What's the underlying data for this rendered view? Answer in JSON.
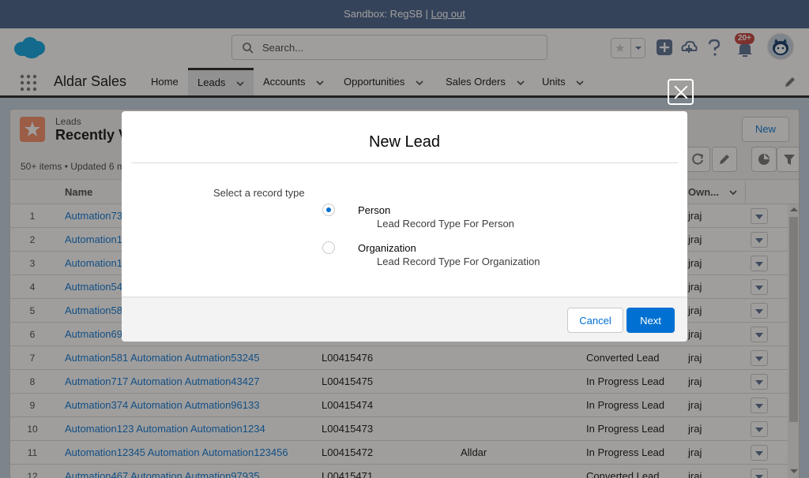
{
  "sandbox": {
    "text": "Sandbox: RegSB | ",
    "logout": "Log out"
  },
  "header": {
    "search_placeholder": "Search...",
    "notifications_badge": "20+",
    "icons": [
      "cloud-logo",
      "search-icon",
      "favorite-star-icon",
      "add-icon",
      "setup-icon",
      "help-icon",
      "notification-bell-icon",
      "avatar"
    ]
  },
  "nav": {
    "app_name": "Aldar Sales",
    "items": [
      {
        "label": "Home",
        "has_menu": false,
        "active": false
      },
      {
        "label": "Leads",
        "has_menu": true,
        "active": true
      },
      {
        "label": "Accounts",
        "has_menu": true,
        "active": false
      },
      {
        "label": "Opportunities",
        "has_menu": true,
        "active": false
      },
      {
        "label": "Sales Orders",
        "has_menu": true,
        "active": false
      },
      {
        "label": "Units",
        "has_menu": true,
        "active": false
      }
    ]
  },
  "list": {
    "object": "Leads",
    "title": "Recently V",
    "new_button": "New",
    "meta": "50+ items • Updated 6 m",
    "columns": {
      "name": "Name",
      "owner": "Own..."
    },
    "rows": [
      {
        "num": "1",
        "name": "Autmation73",
        "lead_id": "",
        "company": "",
        "status": "",
        "owner": "jraj"
      },
      {
        "num": "2",
        "name": "Automation1",
        "lead_id": "",
        "company": "",
        "status": "",
        "owner": "jraj"
      },
      {
        "num": "3",
        "name": "Automation1",
        "lead_id": "",
        "company": "",
        "status": "",
        "owner": "jraj"
      },
      {
        "num": "4",
        "name": "Autmation54",
        "lead_id": "",
        "company": "",
        "status": "",
        "owner": "jraj"
      },
      {
        "num": "5",
        "name": "Autmation58",
        "lead_id": "",
        "company": "",
        "status": "",
        "owner": "jraj"
      },
      {
        "num": "6",
        "name": "Autmation69",
        "lead_id": "",
        "company": "",
        "status": "",
        "owner": "jraj"
      },
      {
        "num": "7",
        "name": "Autmation581 Automation Autmation53245",
        "lead_id": "L00415476",
        "company": "",
        "status": "Converted Lead",
        "owner": "jraj"
      },
      {
        "num": "8",
        "name": "Autmation717 Automation Autmation43427",
        "lead_id": "L00415475",
        "company": "",
        "status": "In Progress Lead",
        "owner": "jraj"
      },
      {
        "num": "9",
        "name": "Autmation374 Automation Autmation96133",
        "lead_id": "L00415474",
        "company": "",
        "status": "In Progress Lead",
        "owner": "jraj"
      },
      {
        "num": "10",
        "name": "Automation123 Automation Automation1234",
        "lead_id": "L00415473",
        "company": "",
        "status": "In Progress Lead",
        "owner": "jraj"
      },
      {
        "num": "11",
        "name": "Automation12345 Automation Automation123456",
        "lead_id": "L00415472",
        "company": "Alldar",
        "status": "In Progress Lead",
        "owner": "jraj"
      },
      {
        "num": "12",
        "name": "Autmation467 Automation Autmation97935",
        "lead_id": "L00415471",
        "company": "",
        "status": "Converted Lead",
        "owner": "jraj"
      }
    ]
  },
  "modal": {
    "title": "New Lead",
    "select_label": "Select a record type",
    "options": [
      {
        "title": "Person",
        "description": "Lead Record Type For Person",
        "checked": true
      },
      {
        "title": "Organization",
        "description": "Lead Record Type For Organization",
        "checked": false
      }
    ],
    "cancel_label": "Cancel",
    "next_label": "Next"
  },
  "colors": {
    "brand": "#0070d2",
    "sandbox_bar": "#3c5a85",
    "lead_icon": "#f88962"
  }
}
